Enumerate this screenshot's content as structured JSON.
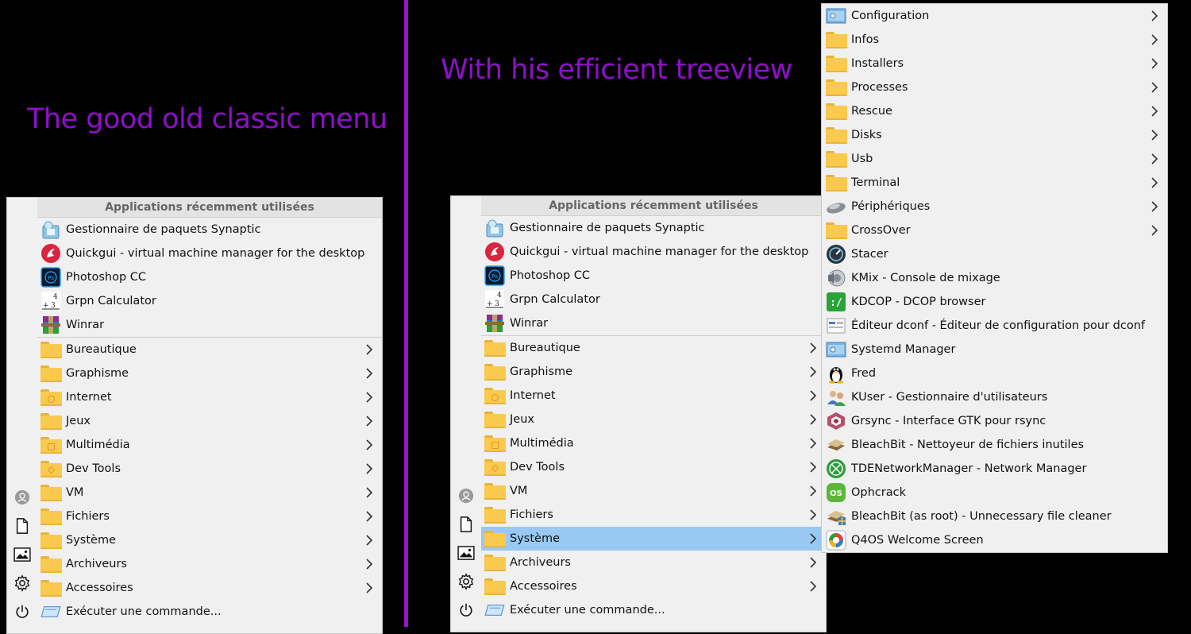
{
  "captions": {
    "left": "The good old classic menu",
    "right": "With his efficient treeview"
  },
  "menu": {
    "header": "Applications récemment utilisées",
    "recent": [
      {
        "label": "Gestionnaire de paquets Synaptic",
        "icon": "synaptic-icon"
      },
      {
        "label": "Quickgui - virtual machine manager for the desktop",
        "icon": "quickgui-icon"
      },
      {
        "label": "Photoshop CC",
        "icon": "photoshop-icon"
      },
      {
        "label": "Grpn Calculator",
        "icon": "calculator-icon"
      },
      {
        "label": "Winrar",
        "icon": "winrar-icon"
      }
    ],
    "categories": [
      {
        "label": "Bureautique"
      },
      {
        "label": "Graphisme"
      },
      {
        "label": "Internet"
      },
      {
        "label": "Jeux"
      },
      {
        "label": "Multimédia"
      },
      {
        "label": "Dev Tools"
      },
      {
        "label": "VM"
      },
      {
        "label": "Fichiers"
      },
      {
        "label": "Système"
      },
      {
        "label": "Archiveurs"
      },
      {
        "label": "Accessoires"
      }
    ],
    "run_command": "Exécuter une commande...",
    "selected_category": "Système"
  },
  "sidebar_icons": [
    "user-icon",
    "document-icon",
    "image-icon",
    "gear-icon",
    "power-icon"
  ],
  "submenu": {
    "items": [
      {
        "label": "Configuration",
        "icon": "configuration-icon",
        "has_sub": true
      },
      {
        "label": "Infos",
        "icon": "folder-icon",
        "has_sub": true
      },
      {
        "label": "Installers",
        "icon": "folder-icon",
        "has_sub": true
      },
      {
        "label": "Processes",
        "icon": "folder-icon",
        "has_sub": true
      },
      {
        "label": "Rescue",
        "icon": "folder-icon",
        "has_sub": true
      },
      {
        "label": "Disks",
        "icon": "folder-icon",
        "has_sub": true
      },
      {
        "label": "Usb",
        "icon": "folder-icon",
        "has_sub": true
      },
      {
        "label": "Terminal",
        "icon": "folder-icon",
        "has_sub": true
      },
      {
        "label": "Périphériques",
        "icon": "mouse-icon",
        "has_sub": true
      },
      {
        "label": "CrossOver",
        "icon": "folder-icon",
        "has_sub": true
      },
      {
        "label": "Stacer",
        "icon": "stacer-icon",
        "has_sub": false
      },
      {
        "label": "KMix - Console de mixage",
        "icon": "speaker-icon",
        "has_sub": false
      },
      {
        "label": "KDCOP - DCOP browser",
        "icon": "kdcop-icon",
        "has_sub": false
      },
      {
        "label": "Éditeur dconf - Éditeur de configuration pour dconf",
        "icon": "dconf-icon",
        "has_sub": false
      },
      {
        "label": "Systemd Manager",
        "icon": "configuration-icon",
        "has_sub": false
      },
      {
        "label": "Fred",
        "icon": "tux-icon",
        "has_sub": false
      },
      {
        "label": "KUser - Gestionnaire d'utilisateurs",
        "icon": "users-icon",
        "has_sub": false
      },
      {
        "label": "Grsync - Interface GTK pour rsync",
        "icon": "grsync-icon",
        "has_sub": false
      },
      {
        "label": "BleachBit - Nettoyeur de fichiers inutiles",
        "icon": "bleachbit-icon",
        "has_sub": false
      },
      {
        "label": "TDENetworkManager - Network Manager",
        "icon": "network-icon",
        "has_sub": false
      },
      {
        "label": "Ophcrack",
        "icon": "ophcrack-icon",
        "has_sub": false
      },
      {
        "label": "BleachBit (as root) - Unnecessary file cleaner",
        "icon": "bleachbit-root-icon",
        "has_sub": false
      },
      {
        "label": "Q4OS Welcome Screen",
        "icon": "q4os-icon",
        "has_sub": false
      }
    ]
  },
  "colors": {
    "caption": "#8f0fc9",
    "selection": "#99c9f3",
    "folder": "#fbc94d"
  }
}
